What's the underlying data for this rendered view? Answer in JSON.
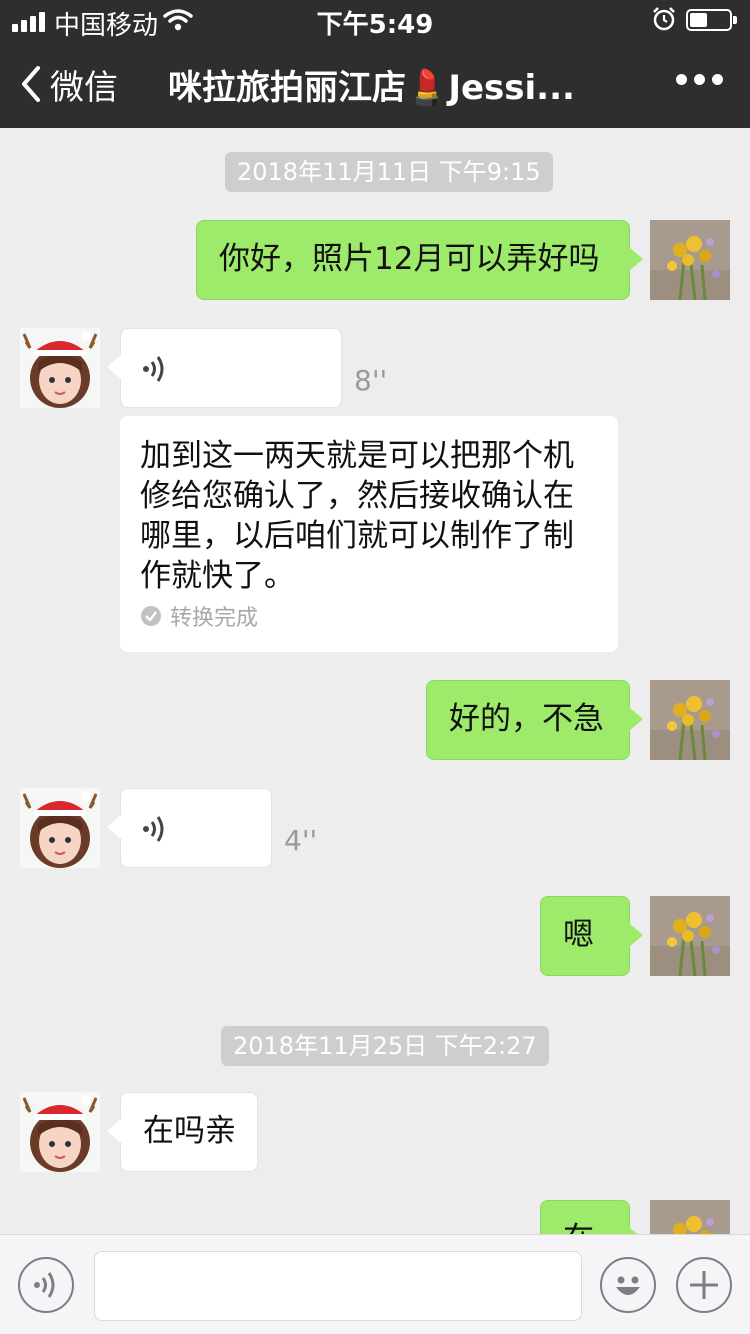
{
  "status_bar": {
    "carrier": "中国移动",
    "time": "下午5:49",
    "battery_level": 0.45
  },
  "nav": {
    "back_label": "微信",
    "title": "咪拉旅拍丽江店💄Jessi...",
    "more_icon": "more-dots-icon"
  },
  "messages": [
    {
      "type": "timestamp",
      "text": "2018年11月11日 下午9:15"
    },
    {
      "type": "text",
      "from": "me",
      "text": "你好，照片12月可以弄好吗"
    },
    {
      "type": "voice",
      "from": "them",
      "duration": "8''"
    },
    {
      "type": "transcript",
      "from": "them",
      "text": "加到这一两天就是可以把那个机修给您确认了，然后接收确认在哪里，以后咱们就可以制作了制作就快了。",
      "status": "转换完成"
    },
    {
      "type": "text",
      "from": "me",
      "text": "好的，不急"
    },
    {
      "type": "voice",
      "from": "them",
      "duration": "4''"
    },
    {
      "type": "text",
      "from": "me",
      "text": "嗯"
    },
    {
      "type": "timestamp",
      "text": "2018年11月25日 下午2:27"
    },
    {
      "type": "text",
      "from": "them",
      "text": "在吗亲"
    },
    {
      "type": "text",
      "from": "me",
      "text": "在"
    }
  ],
  "input_bar": {
    "voice_icon": "voice-input-icon",
    "emoji_icon": "emoji-icon",
    "plus_icon": "plus-icon",
    "message_value": ""
  },
  "colors": {
    "nav_bg": "#2e2e2e",
    "chat_bg": "#ededed",
    "my_bubble": "#9eea6a",
    "their_bubble": "#ffffff"
  }
}
